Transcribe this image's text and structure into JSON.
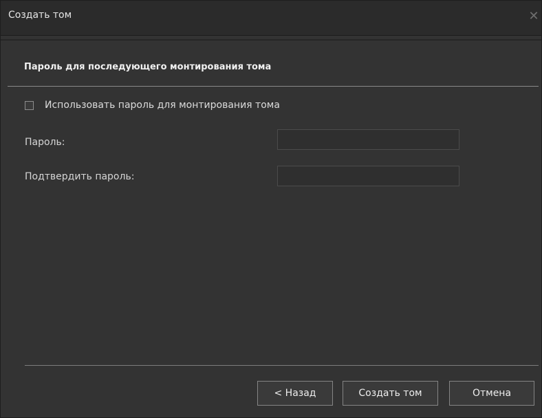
{
  "window": {
    "title": "Создать том",
    "close_glyph": "✕"
  },
  "section": {
    "title": "Пароль для последующего монтирования тома"
  },
  "form": {
    "use_password_label": "Использовать пароль для монтирования тома",
    "use_password_checked": false,
    "password_label": "Пароль:",
    "password_value": "",
    "confirm_label": "Подтвердить пароль:",
    "confirm_value": ""
  },
  "buttons": {
    "back": "< Назад",
    "create": "Создать том",
    "cancel": "Отмена"
  },
  "colors": {
    "background": "#333333",
    "titlebar": "#2b2b2b",
    "text": "#e6e6e6",
    "button_border": "#858585"
  }
}
